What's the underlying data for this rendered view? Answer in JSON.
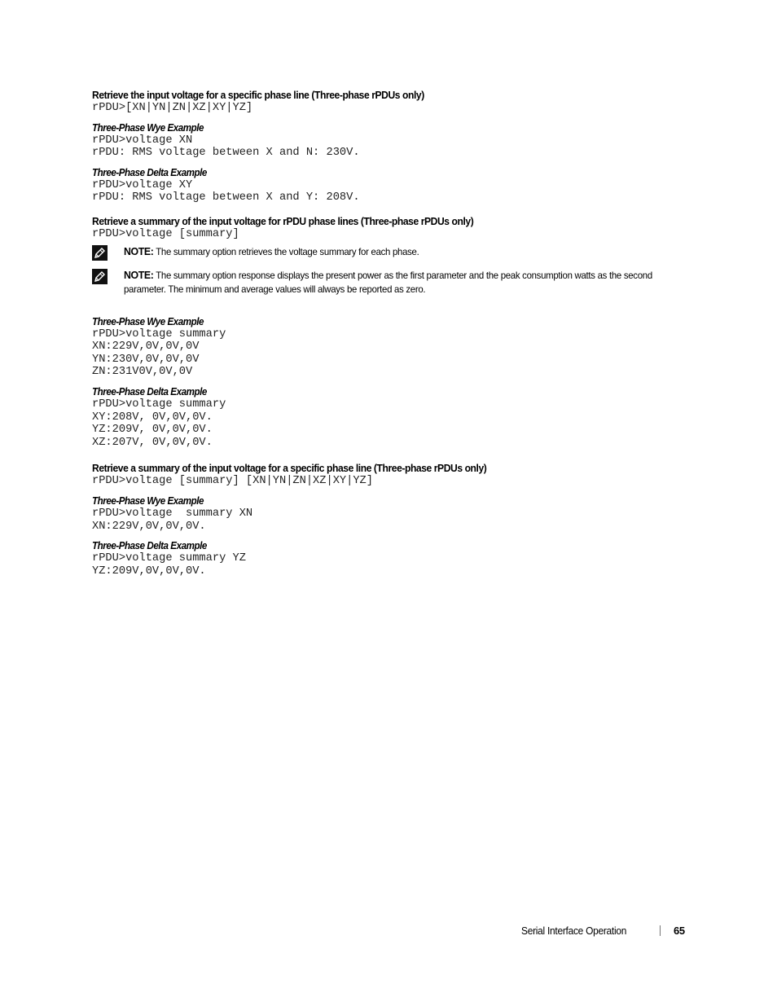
{
  "sections": [
    {
      "heading": "Retrieve the input voltage for a specific phase line (Three-phase rPDUs only)",
      "syntax": "rPDU>[XN|YN|ZN|XZ|XY|YZ]",
      "examples": [
        {
          "title": "Three-Phase Wye Example",
          "lines": [
            "rPDU>voltage XN",
            "rPDU: RMS voltage between X and N: 230V."
          ]
        },
        {
          "title": "Three-Phase Delta Example",
          "lines": [
            "rPDU>voltage XY",
            "rPDU: RMS voltage between X and Y: 208V."
          ]
        }
      ]
    },
    {
      "heading": "Retrieve a summary of the input voltage for rPDU phase lines (Three-phase rPDUs only)",
      "syntax": "rPDU>voltage [summary]",
      "notes": [
        {
          "label": "NOTE:",
          "text": " The summary option retrieves the voltage summary for each phase.",
          "icon": "note-pencil-icon"
        },
        {
          "label": "NOTE:",
          "text": " The summary option response displays the present power as the first parameter and the peak consumption watts as the second parameter. The minimum and average values will always be reported as zero.",
          "icon": "note-pencil-icon"
        }
      ],
      "examples": [
        {
          "title": "Three-Phase Wye Example",
          "lines": [
            "rPDU>voltage summary",
            "XN:229V,0V,0V,0V",
            "YN:230V,0V,0V,0V",
            "ZN:231V0V,0V,0V"
          ]
        },
        {
          "title": "Three-Phase Delta Example",
          "lines": [
            "rPDU>voltage summary",
            "XY:208V, 0V,0V,0V.",
            "YZ:209V, 0V,0V,0V.",
            "XZ:207V, 0V,0V,0V."
          ]
        }
      ]
    },
    {
      "heading": "Retrieve a summary of the input voltage for a specific phase line (Three-phase rPDUs only)",
      "syntax": "rPDU>voltage [summary] [XN|YN|ZN|XZ|XY|YZ]",
      "examples": [
        {
          "title": "Three-Phase Wye Example",
          "lines": [
            "rPDU>voltage  summary XN",
            "XN:229V,0V,0V,0V."
          ]
        },
        {
          "title": "Three-Phase Delta Example",
          "lines": [
            "rPDU>voltage summary YZ",
            "YZ:209V,0V,0V,0V."
          ]
        }
      ]
    }
  ],
  "footer": {
    "title": "Serial Interface Operation",
    "page_number": "65"
  }
}
